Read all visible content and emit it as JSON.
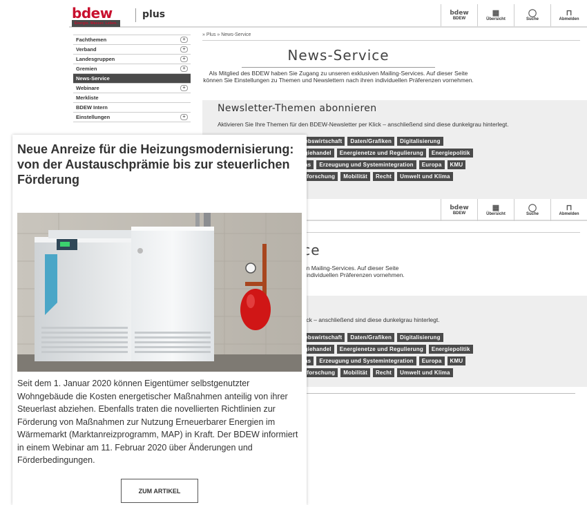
{
  "header": {
    "logo": "bdew",
    "tagline": "Energie. Wasser. Leben.",
    "product": "plus",
    "nav": [
      {
        "icon": "bdew-logo-icon",
        "label": "BDEW"
      },
      {
        "icon": "grid-icon",
        "label": "Übersicht"
      },
      {
        "icon": "search-icon",
        "label": "Suche"
      },
      {
        "icon": "unlock-icon",
        "label": "Abmelden"
      }
    ]
  },
  "sidebar": {
    "items": [
      {
        "label": "Fachthemen",
        "expand": true
      },
      {
        "label": "Verband",
        "expand": true
      },
      {
        "label": "Landesgruppen",
        "expand": true
      },
      {
        "label": "Gremien",
        "expand": true
      },
      {
        "label": "News-Service",
        "expand": false,
        "active": true
      },
      {
        "label": "Webinare",
        "expand": true
      },
      {
        "label": "Merkliste",
        "expand": false
      },
      {
        "label": "BDEW Intern",
        "expand": false
      },
      {
        "label": "Einstellungen",
        "expand": true
      }
    ]
  },
  "breadcrumb": "» Plus » News-Service",
  "page": {
    "title": "News-Service",
    "intro": "Als Mitglied des BDEW haben Sie Zugang zu unseren exklusiven Mailing-Services. Auf dieser Seite können Sie Einstellungen zu Themen und Newslettern nach ihren individuellen Präferenzen vornehmen."
  },
  "newsletter": {
    "title": "Newsletter-Themen abonnieren",
    "desc": "Aktivieren Sie Ihre Themen für den BDEW-Newsletter per Klick – anschließend sind diese dunkelgrau hinterlegt.",
    "rows": [
      [
        "Betriebswirtschaft",
        "Daten/Grafiken",
        "Digitalisierung"
      ],
      [
        "Energiehandel",
        "Energienetze und Regulierung",
        "Energiepolitik"
      ],
      [
        "Erdgas",
        "Erzeugung und Systemintegration",
        "Europa",
        "KMU"
      ],
      [
        "Marktforschung",
        "Mobilität",
        "Recht",
        "Umwelt und Klima"
      ]
    ]
  },
  "article": {
    "title": "Neue Anreize für die Heizungsmodernisierung: von der Austauschprämie bis zur steuerlichen Förderung",
    "text": "Seit dem 1. Januar 2020 können Eigentümer selbstgenutzter Wohngebäude die Kosten energetischer Maßnahmen anteilig von ihrer Steuerlast abziehen. Ebenfalls traten die novellierten Richtlinien zur Förderung von Maßnahmen zur Nutzung Erneuerbarer Energien im Wärmemarkt (Marktanreizprogramm, MAP) in Kraft. Der BDEW informiert in einem Webinar am 11. Februar 2020 über Änderungen und Förderbedingungen.",
    "button": "ZUM ARTIKEL"
  },
  "colors": {
    "brand": "#c8102e",
    "tag": "#4a4a4a",
    "box": "#eeeeee"
  }
}
